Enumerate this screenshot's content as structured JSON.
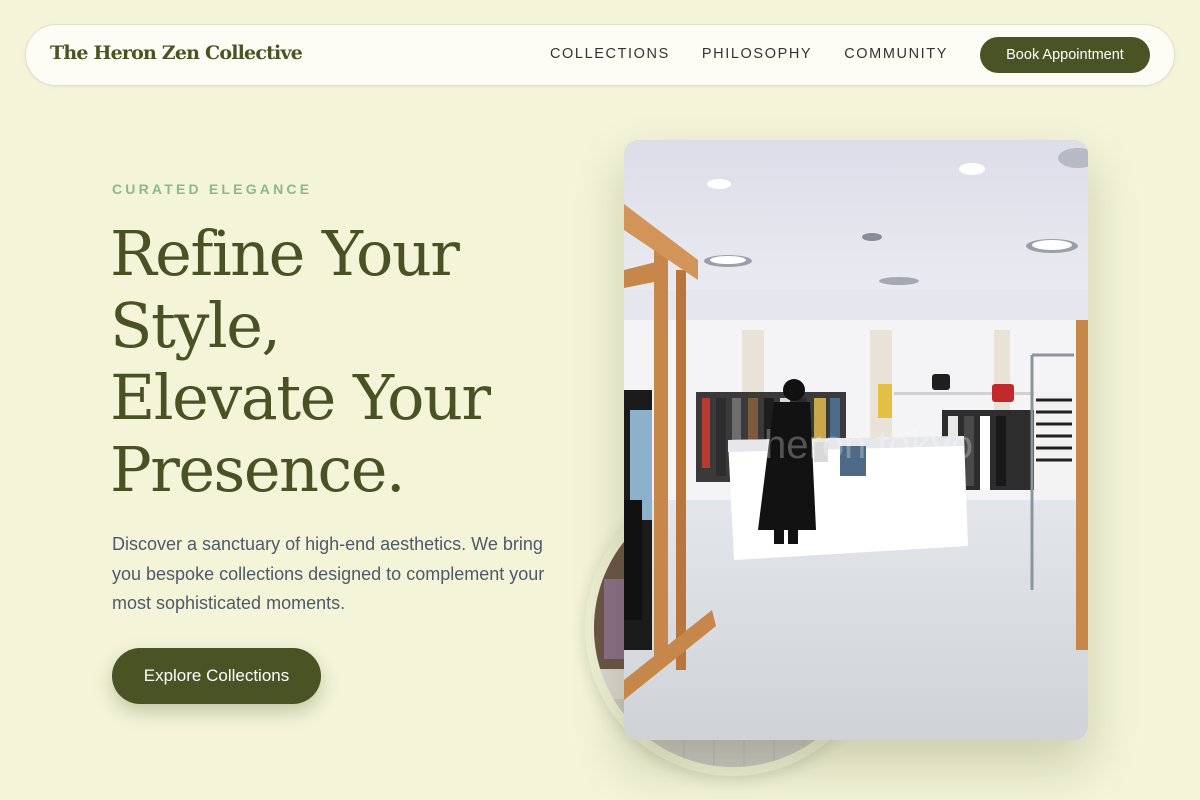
{
  "nav": {
    "brand": "The Heron Zen Collective",
    "links": [
      "COLLECTIONS",
      "PHILOSOPHY",
      "COMMUNITY"
    ],
    "cta_label": "Book Appointment"
  },
  "hero": {
    "eyebrow": "CURATED ELEGANCE",
    "headline_lines": [
      "Refine Your",
      "Style,",
      "Elevate Your",
      "Presence."
    ],
    "description": "Discover a sanctuary of high-end aesthetics. We bring you bespoke collections designed to complement your most sophisticated moments.",
    "cta_label": "Explore Collections",
    "photo_watermark": "heron tokyo"
  },
  "colors": {
    "background": "#f3f4d8",
    "accent": "#4a5324",
    "eyebrow": "#8db88c",
    "body_text": "#4e5a69"
  }
}
